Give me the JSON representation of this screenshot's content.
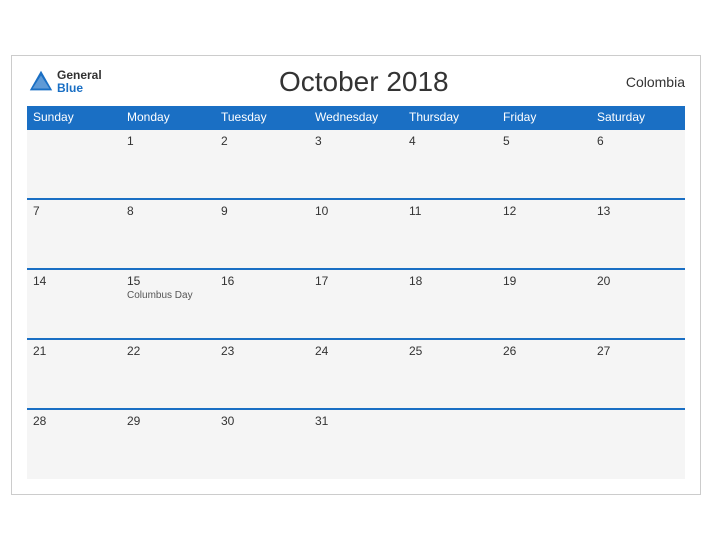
{
  "header": {
    "logo_general": "General",
    "logo_blue": "Blue",
    "title": "October 2018",
    "country": "Colombia"
  },
  "weekdays": [
    "Sunday",
    "Monday",
    "Tuesday",
    "Wednesday",
    "Thursday",
    "Friday",
    "Saturday"
  ],
  "weeks": [
    [
      {
        "day": "",
        "empty": true
      },
      {
        "day": "1"
      },
      {
        "day": "2"
      },
      {
        "day": "3"
      },
      {
        "day": "4"
      },
      {
        "day": "5"
      },
      {
        "day": "6"
      }
    ],
    [
      {
        "day": "7"
      },
      {
        "day": "8"
      },
      {
        "day": "9"
      },
      {
        "day": "10"
      },
      {
        "day": "11"
      },
      {
        "day": "12"
      },
      {
        "day": "13"
      }
    ],
    [
      {
        "day": "14"
      },
      {
        "day": "15",
        "event": "Columbus Day"
      },
      {
        "day": "16"
      },
      {
        "day": "17"
      },
      {
        "day": "18"
      },
      {
        "day": "19"
      },
      {
        "day": "20"
      }
    ],
    [
      {
        "day": "21"
      },
      {
        "day": "22"
      },
      {
        "day": "23"
      },
      {
        "day": "24"
      },
      {
        "day": "25"
      },
      {
        "day": "26"
      },
      {
        "day": "27"
      }
    ],
    [
      {
        "day": "28"
      },
      {
        "day": "29"
      },
      {
        "day": "30"
      },
      {
        "day": "31"
      },
      {
        "day": "",
        "empty": true
      },
      {
        "day": "",
        "empty": true
      },
      {
        "day": "",
        "empty": true
      }
    ]
  ]
}
